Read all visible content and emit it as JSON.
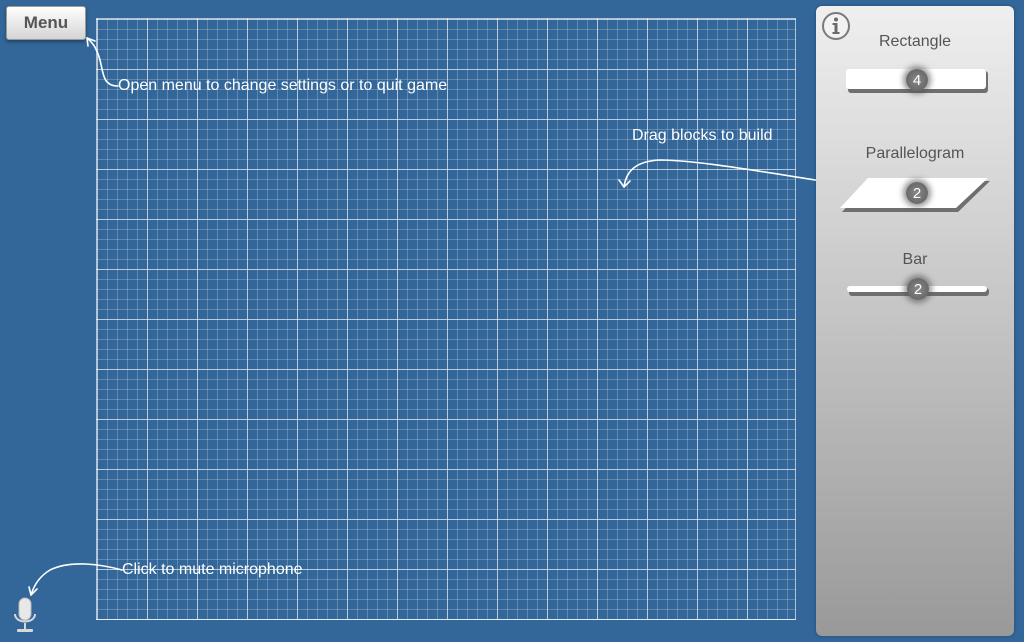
{
  "menu": {
    "label": "Menu"
  },
  "hints": {
    "menu": "Open menu to change settings or to quit game",
    "drag": "Drag blocks to build",
    "mic": "Click to mute microphone"
  },
  "palette": {
    "blocks": [
      {
        "label": "Rectangle",
        "count": "4"
      },
      {
        "label": "Parallelogram",
        "count": "2"
      },
      {
        "label": "Bar",
        "count": "2"
      }
    ]
  },
  "icons": {
    "info": "info-icon",
    "mic": "microphone-icon"
  },
  "colors": {
    "background": "#336699",
    "grid_line": "#ffffff",
    "panel_top": "#efefef",
    "panel_bottom": "#999999"
  }
}
